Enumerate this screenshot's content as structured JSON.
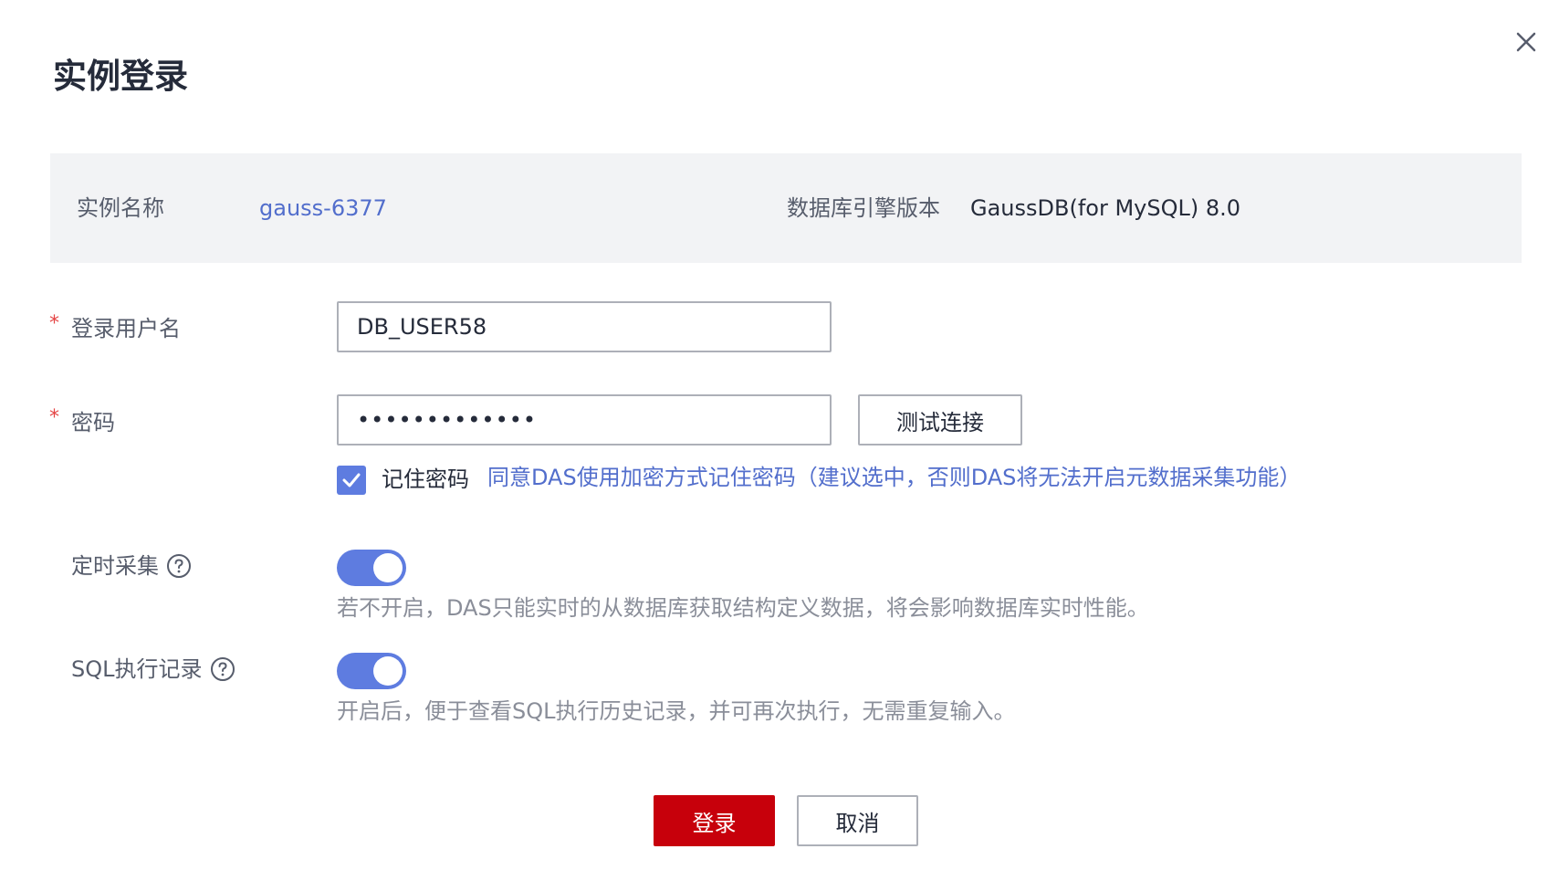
{
  "dialog": {
    "title": "实例登录",
    "close_icon": "close-icon"
  },
  "instance_info": {
    "name_label": "实例名称",
    "name_value": "gauss-6377",
    "engine_label": "数据库引擎版本",
    "engine_value": "GaussDB(for MySQL) 8.0"
  },
  "form": {
    "username": {
      "label": "登录用户名",
      "required_mark": "*",
      "value": "DB_USER58"
    },
    "password": {
      "label": "密码",
      "required_mark": "*",
      "value": "•••••••••••••"
    },
    "test_connection_label": "测试连接",
    "remember": {
      "checked": true,
      "label": "记住密码",
      "hint": "同意DAS使用加密方式记住密码（建议选中，否则DAS将无法开启元数据采集功能）"
    },
    "scheduled_collection": {
      "label": "定时采集",
      "help_icon": "question-circle-icon",
      "enabled": true,
      "hint": "若不开启，DAS只能实时的从数据库获取结构定义数据，将会影响数据库实时性能。"
    },
    "sql_record": {
      "label": "SQL执行记录",
      "help_icon": "question-circle-icon",
      "enabled": true,
      "hint": "开启后，便于查看SQL执行历史记录，并可再次执行，无需重复输入。"
    }
  },
  "footer": {
    "login_label": "登录",
    "cancel_label": "取消"
  },
  "colors": {
    "primary_button": "#c7000b",
    "link": "#526ecc",
    "toggle_on": "#5e7ce0",
    "info_background": "#f2f3f5"
  }
}
